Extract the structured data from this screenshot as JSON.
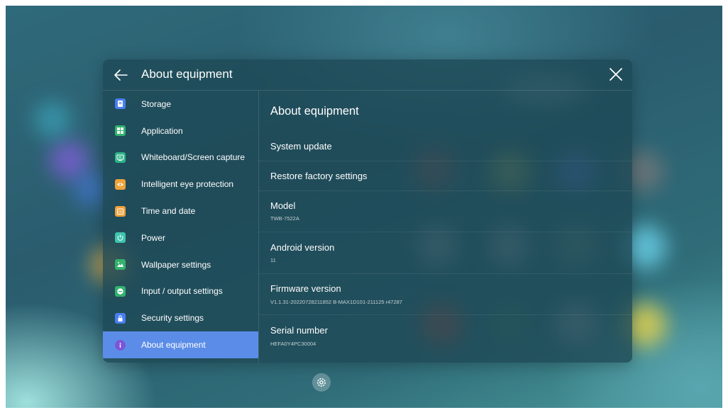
{
  "header": {
    "title": "About equipment"
  },
  "sidebar": {
    "items": [
      {
        "label": "Storage",
        "icon": "storage-icon",
        "color": "#4a7ff0"
      },
      {
        "label": "Application",
        "icon": "application-icon",
        "color": "#33b36e"
      },
      {
        "label": "Whiteboard/Screen capture",
        "icon": "whiteboard-icon",
        "color": "#2fb38a"
      },
      {
        "label": "Intelligent eye protection",
        "icon": "eye-protection-icon",
        "color": "#f0a23a"
      },
      {
        "label": "Time and date",
        "icon": "calendar-icon",
        "color": "#f0a23a"
      },
      {
        "label": "Power",
        "icon": "power-icon",
        "color": "#3fc4ae"
      },
      {
        "label": "Wallpaper settings",
        "icon": "wallpaper-icon",
        "color": "#33b36e"
      },
      {
        "label": "Input / output settings",
        "icon": "input-output-icon",
        "color": "#33b36e"
      },
      {
        "label": "Security settings",
        "icon": "lock-icon",
        "color": "#4a7ff0"
      },
      {
        "label": "About equipment",
        "icon": "info-icon",
        "color": "#7b55d9",
        "active": true
      }
    ]
  },
  "content": {
    "title": "About equipment",
    "system_update": "System update",
    "restore_factory": "Restore factory settings",
    "model": {
      "label": "Model",
      "value": "TWB-7522A"
    },
    "android": {
      "label": "Android version",
      "value": "11"
    },
    "firmware": {
      "label": "Firmware version",
      "value": "V1.1.31-20220728211852 B-MAX1D101-211125 r47287"
    },
    "serial": {
      "label": "Serial number",
      "value": "HEFA0Y4PC30004"
    }
  },
  "colors": {
    "accent": "#5b8de8"
  }
}
